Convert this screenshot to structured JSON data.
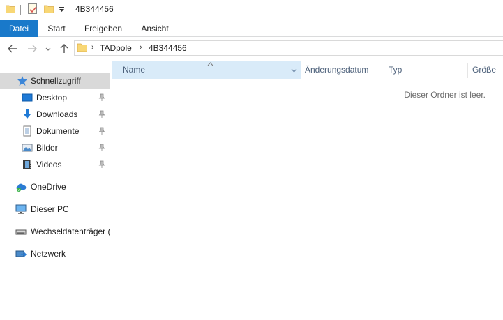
{
  "window": {
    "title": "4B344456"
  },
  "ribbon": {
    "tabs": [
      {
        "label": "Datei"
      },
      {
        "label": "Start"
      },
      {
        "label": "Freigeben"
      },
      {
        "label": "Ansicht"
      }
    ]
  },
  "address": {
    "breadcrumb": [
      "TADpole",
      "4B344456"
    ]
  },
  "nav": {
    "quick_access": {
      "label": "Schnellzugriff"
    },
    "pinned": [
      {
        "label": "Desktop",
        "icon": "desktop-icon"
      },
      {
        "label": "Downloads",
        "icon": "download-icon"
      },
      {
        "label": "Dokumente",
        "icon": "document-icon"
      },
      {
        "label": "Bilder",
        "icon": "pictures-icon"
      },
      {
        "label": "Videos",
        "icon": "videos-icon"
      }
    ],
    "onedrive": {
      "label": "OneDrive"
    },
    "this_pc": {
      "label": "Dieser PC"
    },
    "removable": {
      "label": "Wechseldatenträger ("
    },
    "network": {
      "label": "Netzwerk"
    }
  },
  "columns": {
    "name": "Name",
    "modified": "Änderungsdatum",
    "type": "Typ",
    "size": "Größe"
  },
  "content": {
    "empty_message": "Dieser Ordner ist leer."
  },
  "colors": {
    "accent": "#1979ca",
    "selected_nav": "#d9d9d9",
    "header_highlight": "#d9ebf9",
    "header_text": "#4c607a",
    "folder": "#f8d775"
  }
}
